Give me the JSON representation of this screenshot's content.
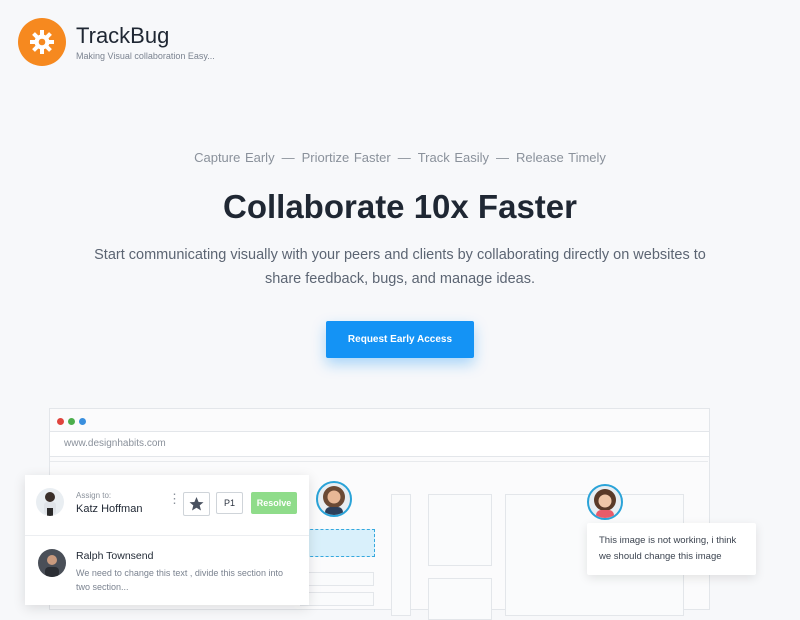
{
  "brand": {
    "title": "TrackBug",
    "tagline": "Making Visual collaboration Easy..."
  },
  "hero": {
    "steps": [
      "Capture Early",
      "Priortize Faster",
      "Track Easily",
      "Release Timely"
    ],
    "separator": "—",
    "headline": "Collaborate 10x Faster",
    "subtitle": "Start communicating visually with your peers and clients by collaborating directly on websites to share feedback, bugs, and manage ideas.",
    "cta_label": "Request Early Access"
  },
  "browser": {
    "url": "www.designhabits.com",
    "dot_colors": [
      "#e0443e",
      "#4cae4c",
      "#3a8fde"
    ]
  },
  "task_card": {
    "assign_label": "Assign to:",
    "assignee": "Katz Hoffman",
    "priority": "P1",
    "resolve_label": "Resolve",
    "comment_author": "Ralph Townsend",
    "comment_text": "We need to change this text , divide this section into two section..."
  },
  "comment_bubble": {
    "text": "This image is not working, i think we should change this image"
  },
  "colors": {
    "brand": "#f6891f",
    "accent": "#1493f5",
    "resolve": "#8fdc8a",
    "avatar_ring": "#2aa3d8"
  },
  "icons": [
    "gear-icon",
    "star-icon",
    "kebab-menu-icon"
  ]
}
